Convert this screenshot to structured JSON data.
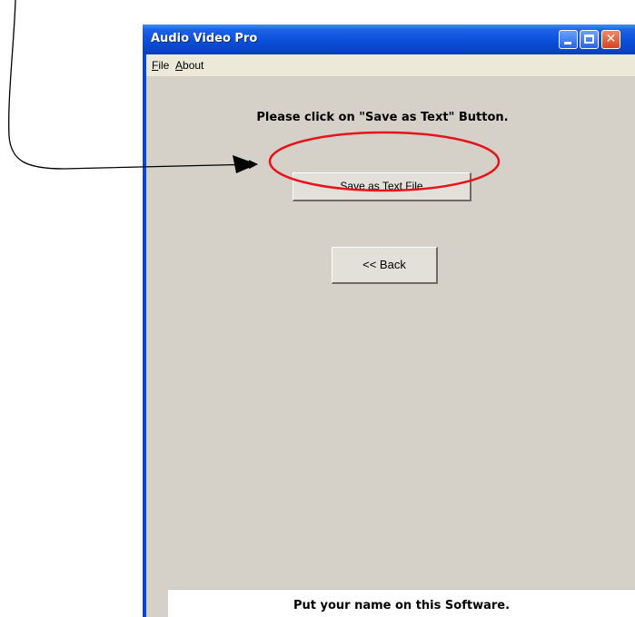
{
  "window": {
    "title": "Audio Video Pro",
    "close_symbol": "✕"
  },
  "menu": {
    "file_accel": "F",
    "file_rest": "ile",
    "about_accel": "A",
    "about_rest": "bout"
  },
  "content": {
    "instruction": "Please click on \"Save as Text\" Button.",
    "save_button": "Save as Text File",
    "back_button": "<< Back",
    "footer": "Put your name on this Software."
  },
  "colors": {
    "titlebar_blue": "#0a4fd8",
    "annotation_red": "#e8121a",
    "panel_bg": "#d5d0c8"
  },
  "icons": [
    "minimize-icon",
    "maximize-icon",
    "close-icon",
    "arrow-pointer"
  ]
}
